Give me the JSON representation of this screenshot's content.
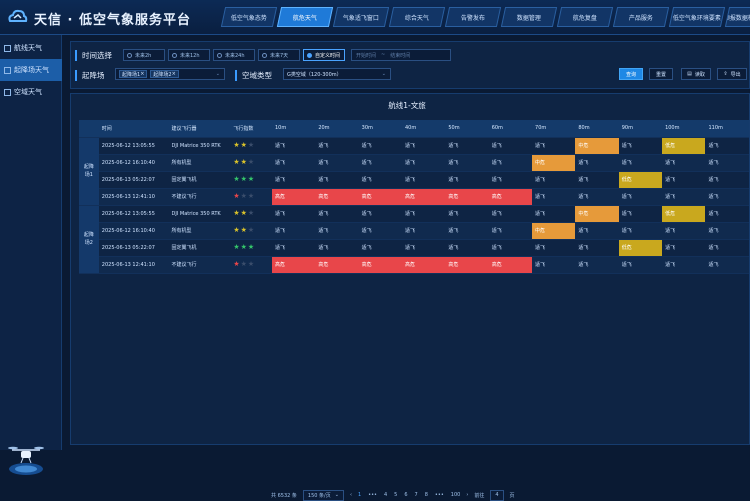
{
  "app": {
    "title": "天信 · 低空气象服务平台"
  },
  "nav": [
    "低空气象态势",
    "航危天气",
    "气象适飞窗口",
    "综合天气",
    "告警发布",
    "数据管理",
    "航危复盘",
    "产品服务",
    "低空气象环境要素",
    "预报数据检验"
  ],
  "nav_active": 1,
  "sidebar": {
    "items": [
      "航线天气",
      "起降场天气",
      "空域天气"
    ],
    "active": 1
  },
  "filters": {
    "time_label": "时间选择",
    "time_options": [
      "未来2h",
      "未来12h",
      "未来24h",
      "未来7天",
      "自定义时间"
    ],
    "time_selected": 4,
    "start_placeholder": "开始时间",
    "range_sep": "~",
    "end_placeholder": "结束时间",
    "field_label": "起降场",
    "field_tags": [
      "起降场1",
      "起降场2"
    ],
    "airspace_label": "空域类型",
    "airspace_value": "G类空域（120-300m）",
    "query": "查询",
    "reset": "重置",
    "btn3": "读取",
    "btn4": "导出"
  },
  "panel": {
    "title": "航线1-文旅"
  },
  "table": {
    "columns": [
      "时间",
      "建议飞行器",
      "飞行指数",
      "10m",
      "20m",
      "30m",
      "40m",
      "50m",
      "60m",
      "70m",
      "80m",
      "90m",
      "100m",
      "110m"
    ],
    "groups": [
      {
        "name": "起降场1",
        "rows": [
          {
            "time": "2025-06-12 13:05:55",
            "aircraft": "DJI Matrice 350 RTK",
            "stars": 2,
            "star_color": "#d9c22b",
            "levels": [
              "适飞",
              "适飞",
              "适飞",
              "适飞",
              "适飞",
              "适飞",
              "适飞",
              "中危",
              "适飞",
              "低危",
              "适飞"
            ]
          },
          {
            "time": "2025-06-12 16:10:40",
            "aircraft": "所有机型",
            "stars": 2,
            "star_color": "#d9c22b",
            "levels": [
              "适飞",
              "适飞",
              "适飞",
              "适飞",
              "适飞",
              "适飞",
              "中危",
              "适飞",
              "适飞",
              "适飞",
              "适飞"
            ]
          },
          {
            "time": "2025-06-13 05:22:07",
            "aircraft": "固定翼飞机",
            "stars": 3,
            "star_color": "#34c46a",
            "levels": [
              "适飞",
              "适飞",
              "适飞",
              "适飞",
              "适飞",
              "适飞",
              "适飞",
              "适飞",
              "低危",
              "适飞",
              "适飞"
            ]
          },
          {
            "time": "2025-06-13 12:41:10",
            "aircraft": "不建议飞行",
            "stars": 1,
            "star_color": "#e8464a",
            "levels": [
              "高危",
              "高危",
              "高危",
              "高危",
              "高危",
              "高危",
              "适飞",
              "适飞",
              "适飞",
              "适飞",
              "适飞"
            ]
          }
        ]
      },
      {
        "name": "起降场2",
        "rows": [
          {
            "time": "2025-06-12 13:05:55",
            "aircraft": "DJI Matrice 350 RTK",
            "stars": 2,
            "star_color": "#d9c22b",
            "levels": [
              "适飞",
              "适飞",
              "适飞",
              "适飞",
              "适飞",
              "适飞",
              "适飞",
              "中危",
              "适飞",
              "低危",
              "适飞"
            ]
          },
          {
            "time": "2025-06-12 16:10:40",
            "aircraft": "所有机型",
            "stars": 2,
            "star_color": "#d9c22b",
            "levels": [
              "适飞",
              "适飞",
              "适飞",
              "适飞",
              "适飞",
              "适飞",
              "中危",
              "适飞",
              "适飞",
              "适飞",
              "适飞"
            ]
          },
          {
            "time": "2025-06-13 05:22:07",
            "aircraft": "固定翼飞机",
            "stars": 3,
            "star_color": "#34c46a",
            "levels": [
              "适飞",
              "适飞",
              "适飞",
              "适飞",
              "适飞",
              "适飞",
              "适飞",
              "适飞",
              "低危",
              "适飞",
              "适飞"
            ]
          },
          {
            "time": "2025-06-13 12:41:10",
            "aircraft": "不建议飞行",
            "stars": 1,
            "star_color": "#e8464a",
            "levels": [
              "高危",
              "高危",
              "高危",
              "高危",
              "高危",
              "高危",
              "适飞",
              "适飞",
              "适飞",
              "适飞",
              "适飞"
            ]
          }
        ]
      }
    ],
    "level_colors": {
      "高危": "#e8464a",
      "中危": "#e69a3a",
      "低危": "#c9a81e"
    }
  },
  "pagination": {
    "total": "共 6532 条",
    "page_size": "150 条/页",
    "prev": "‹",
    "pages": [
      "1",
      "•••",
      "4",
      "5",
      "6",
      "7",
      "8",
      "•••",
      "100"
    ],
    "current": "1",
    "next": "›",
    "goto_label": "前往",
    "goto_value": "4",
    "goto_suffix": "页"
  }
}
